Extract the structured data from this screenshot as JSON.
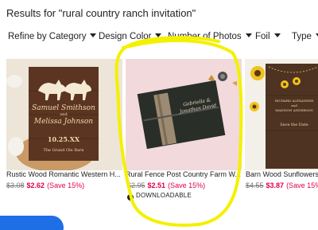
{
  "search": {
    "results_label": "Results for \"rural country ranch invitation\""
  },
  "filters": [
    {
      "label": "Refine by Category"
    },
    {
      "label": "Design Color"
    },
    {
      "label": "Number of Photos"
    },
    {
      "label": "Foil"
    },
    {
      "label": "Type"
    }
  ],
  "products": [
    {
      "title": "Rustic Wood Romantic Western H...",
      "old_price": "$3.08",
      "new_price": "$2.62",
      "save": "(Save 15%)",
      "card_text": {
        "names": "Samuel Smithson",
        "and": "and",
        "names2": "Melissa Johnson",
        "date": "10.25.XX",
        "venue": "The Grand Ole Barn"
      }
    },
    {
      "title": "Rural Fence Post Country Farm W...",
      "old_price": "$2.95",
      "new_price": "$2.51",
      "save": "(Save 15%)",
      "badge": "DOWNLOADABLE",
      "card_text": {
        "names": "Gabriella &",
        "names2": "Jonathan David"
      }
    },
    {
      "title": "Barn Wood Sunflowers F...",
      "old_price": "$4.55",
      "new_price": "$3.87",
      "save": "(Save 15%)",
      "card_text": {
        "names": "RICHARD ALEXANDER",
        "and": "and",
        "names2": "MADISON ANDERSON",
        "date": "Save the Date"
      }
    }
  ],
  "colors": {
    "sale": "#e0004d",
    "accent_blue": "#1e6ee6",
    "highlight": "#f4f000"
  }
}
